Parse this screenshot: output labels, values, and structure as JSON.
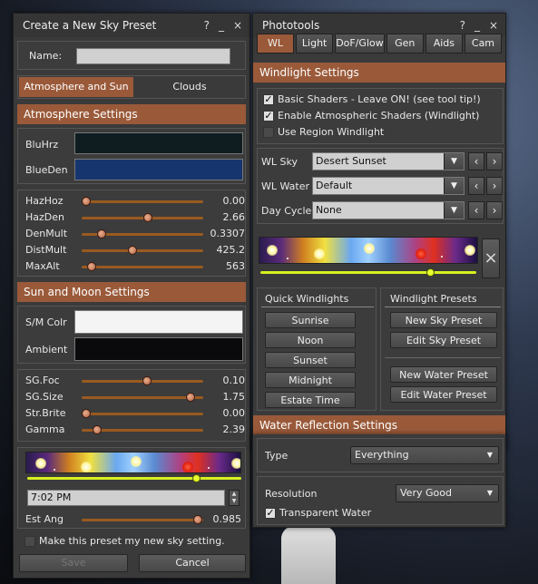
{
  "left": {
    "title": "Create a New Sky Preset",
    "controls": {
      "help": "?",
      "min": "_",
      "close": "×"
    },
    "name_label": "Name:",
    "name_value": "",
    "tabs": [
      "Atmosphere and Sun",
      "Clouds"
    ],
    "atmo_header": "Atmosphere Settings",
    "colors": [
      {
        "label": "BluHrz",
        "color": "#0f1c20"
      },
      {
        "label": "BlueDen",
        "color": "#16356e"
      }
    ],
    "atmo_sliders": [
      {
        "label": "HazHoz",
        "value": "0.00",
        "fraction": 0.0
      },
      {
        "label": "HazDen",
        "value": "2.66",
        "fraction": 0.55
      },
      {
        "label": "DenMult",
        "value": "0.3307",
        "fraction": 0.14
      },
      {
        "label": "DistMult",
        "value": "425.2",
        "fraction": 0.41
      },
      {
        "label": "MaxAlt",
        "value": "563",
        "fraction": 0.05
      }
    ],
    "sun_header": "Sun and Moon Settings",
    "sun_colors": [
      {
        "label": "S/M Colr",
        "color": "#f4f4f4"
      },
      {
        "label": "Ambient",
        "color": "#0a0a0c"
      }
    ],
    "sun_sliders": [
      {
        "label": "SG.Foc",
        "value": "0.10",
        "fraction": 0.54
      },
      {
        "label": "SG.Size",
        "value": "1.75",
        "fraction": 0.93
      },
      {
        "label": "Str.Brite",
        "value": "0.00",
        "fraction": 0.0
      },
      {
        "label": "Gamma",
        "value": "2.39",
        "fraction": 0.1
      }
    ],
    "time_value": "7:02 PM",
    "time_fraction": 0.8,
    "est_ang_label": "Est Ang",
    "est_ang_value": "0.985",
    "est_ang_fraction": 0.99,
    "make_default_label": "Make this preset my new sky setting.",
    "save": "Save",
    "cancel": "Cancel"
  },
  "right": {
    "title": "Phototools",
    "controls": {
      "help": "?",
      "min": "_",
      "close": "×"
    },
    "tabs": [
      "WL",
      "Light",
      "DoF/Glow",
      "Gen",
      "Aids",
      "Cam"
    ],
    "wl_header": "Windlight Settings",
    "checks": [
      {
        "label": "Basic Shaders - Leave ON! (see tool tip!)",
        "checked": true
      },
      {
        "label": "Enable Atmospheric Shaders (Windlight)",
        "checked": true
      },
      {
        "label": "Use Region Windlight",
        "checked": false
      }
    ],
    "combos": [
      {
        "label": "WL Sky",
        "value": "Desert Sunset"
      },
      {
        "label": "WL Water",
        "value": "Default"
      },
      {
        "label": "Day Cycle",
        "value": "None"
      }
    ],
    "time_fraction": 0.8,
    "quick_title": "Quick Windlights",
    "quick": [
      "Sunrise",
      "Noon",
      "Sunset",
      "Midnight",
      "Estate Time"
    ],
    "presets_title": "Windlight Presets",
    "presets": [
      "New Sky Preset",
      "Edit Sky Preset",
      "New Water Preset",
      "Edit Water Preset"
    ],
    "water_header": "Water Reflection Settings",
    "type_label": "Type",
    "type_value": "Everything",
    "res_label": "Resolution",
    "res_value": "Very Good",
    "transparent_label": "Transparent Water",
    "transparent_checked": true
  }
}
